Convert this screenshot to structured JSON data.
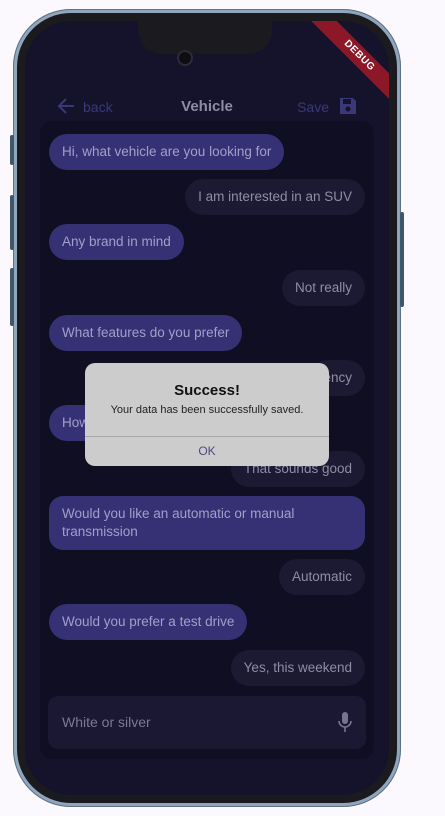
{
  "debug_banner": "DEBUG",
  "appbar": {
    "back_label": "back",
    "title": "Vehicle",
    "save_label": "Save"
  },
  "messages": [
    {
      "from": "bot",
      "text": "Hi, what vehicle are you looking for"
    },
    {
      "from": "user",
      "text": "I am interested in an SUV"
    },
    {
      "from": "bot",
      "text": "Any brand in mind"
    },
    {
      "from": "user",
      "text": "Not really"
    },
    {
      "from": "bot",
      "text": "What features do you prefer"
    },
    {
      "from": "user",
      "text": "ency"
    },
    {
      "from": "bot",
      "text": "How"
    },
    {
      "from": "user",
      "text": "That sounds good"
    },
    {
      "from": "bot",
      "text": "Would you like an automatic or manual transmission"
    },
    {
      "from": "user",
      "text": "Automatic"
    },
    {
      "from": "bot",
      "text": "Would you prefer a test drive"
    },
    {
      "from": "user",
      "text": "Yes, this weekend"
    }
  ],
  "input": {
    "value": "White or silver"
  },
  "dialog": {
    "title": "Success!",
    "message": "Your data has been successfully saved.",
    "ok_label": "OK"
  },
  "colors": {
    "bot_bubble": "#363174",
    "user_bubble": "#1c1a33",
    "background": "#15132b"
  }
}
